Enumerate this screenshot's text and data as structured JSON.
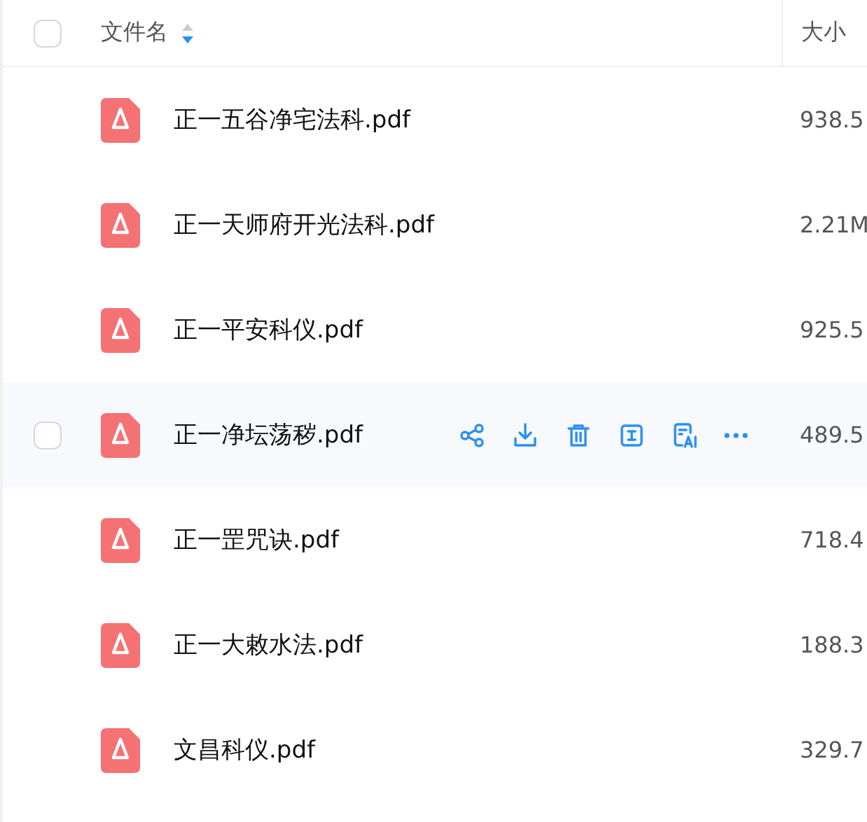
{
  "header": {
    "name_column": "文件名",
    "size_column": "大小",
    "sorted_descending": true,
    "all_checked": false
  },
  "rows": [
    {
      "name": "正一五谷净宅法科.pdf",
      "size": "938.5",
      "hovered": false
    },
    {
      "name": "正一天师府开光法科.pdf",
      "size": "2.21M",
      "hovered": false
    },
    {
      "name": "正一平安科仪.pdf",
      "size": "925.5",
      "hovered": false
    },
    {
      "name": "正一净坛荡秽.pdf",
      "size": "489.5",
      "hovered": true
    },
    {
      "name": "正一罡咒诀.pdf",
      "size": "718.4",
      "hovered": false
    },
    {
      "name": "正一大敕水法.pdf",
      "size": "188.3",
      "hovered": false
    },
    {
      "name": "文昌科仪.pdf",
      "size": "329.7",
      "hovered": false
    }
  ]
}
